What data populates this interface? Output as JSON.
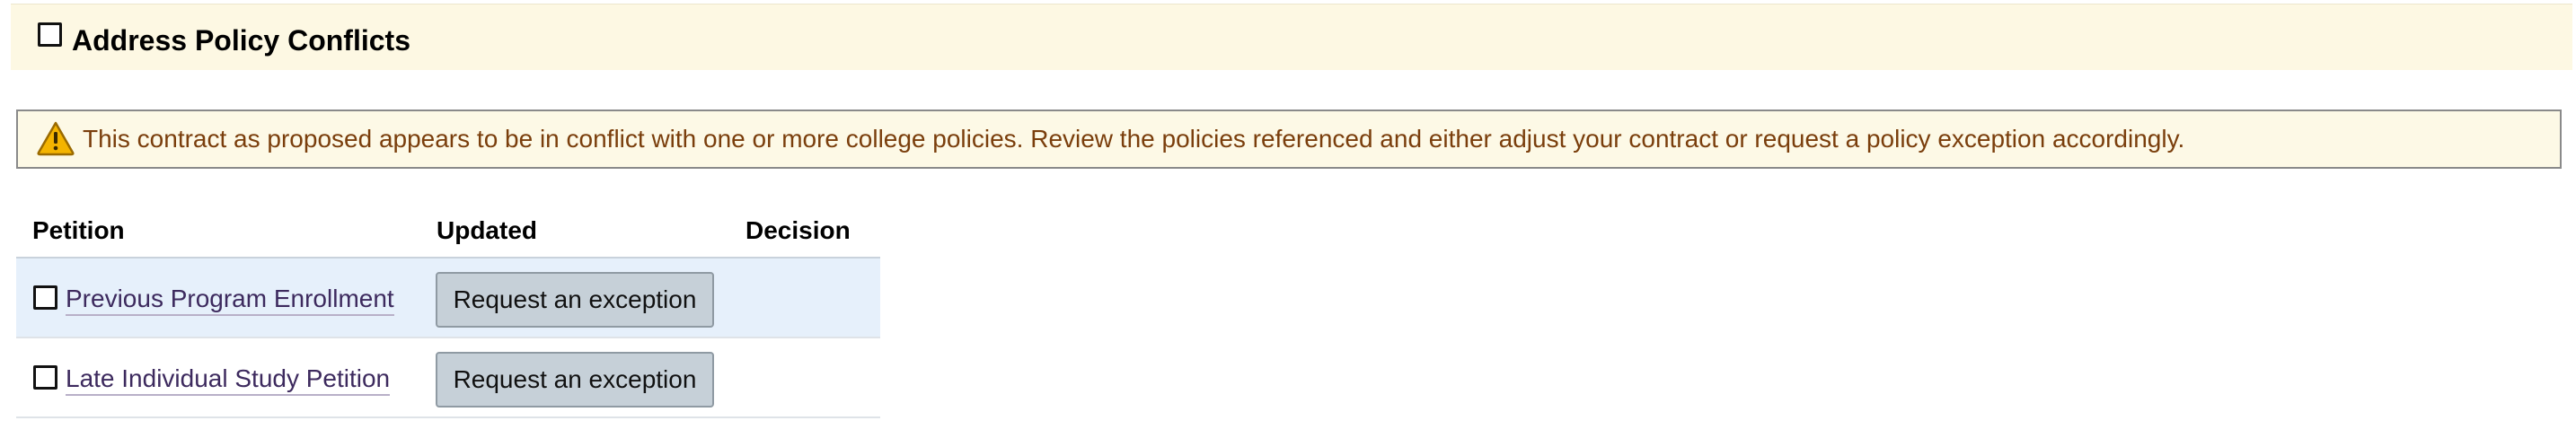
{
  "section": {
    "title": "Address Policy Conflicts"
  },
  "alert": {
    "icon": "warning-icon",
    "message": "This contract as proposed appears to be in conflict with one or more college policies. Review the policies referenced and either adjust your contract or request a policy exception accordingly."
  },
  "table": {
    "headers": {
      "petition": "Petition",
      "updated": "Updated",
      "decision": "Decision"
    },
    "rows": [
      {
        "petition": "Previous Program Enrollment",
        "action_label": "Request an exception",
        "decision": ""
      },
      {
        "petition": "Late Individual Study Petition",
        "action_label": "Request an exception",
        "decision": ""
      }
    ]
  },
  "colors": {
    "header_band": "#fdf8e3",
    "alert_background": "#fdf9e6",
    "alert_text": "#7a3e0c",
    "link_text": "#3d2a5e",
    "row_highlight": "#e6f0fb",
    "button_background": "#c6d0d8"
  }
}
